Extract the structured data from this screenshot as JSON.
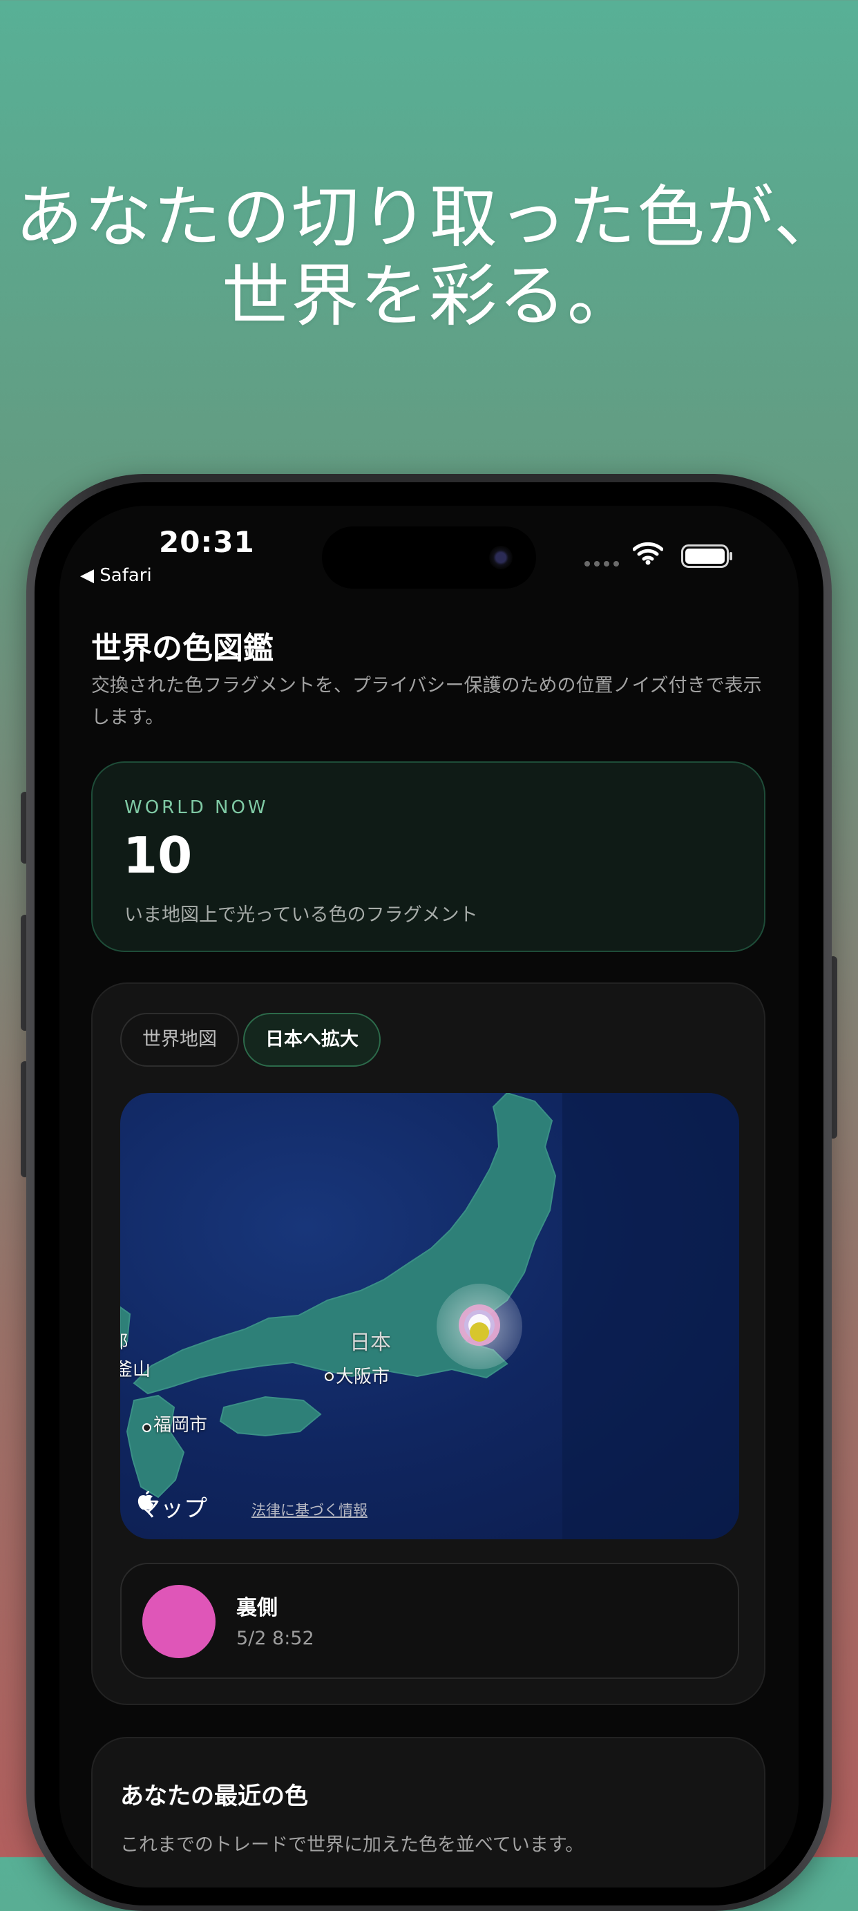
{
  "headline": {
    "line1": "あなたの切り取った色が、",
    "line2": "世界を彩る。"
  },
  "status_bar": {
    "time": "20:31",
    "back_label": "◀ Safari"
  },
  "page": {
    "title": "世界の色図鑑",
    "description": "交換された色フラグメントを、プライバシー保護のための位置ノイズ付きで表示します。"
  },
  "world_now": {
    "label": "WORLD NOW",
    "count": "10",
    "caption": "いま地図上で光っている色のフラグメント"
  },
  "map_section": {
    "tabs": [
      {
        "label": "世界地図",
        "selected": false
      },
      {
        "label": "日本へ拡大",
        "selected": true
      }
    ],
    "map": {
      "country_label": "日本",
      "cities": [
        "大阪市",
        "福岡市"
      ],
      "edge_labels": [
        "郎",
        "釜山"
      ],
      "attribution": "マップ",
      "legal_link": "法律に基づく情報"
    }
  },
  "latest_fragment": {
    "name": "裏側",
    "time": "5/2 8:52",
    "color": "#df56b8"
  },
  "recent_colors": {
    "title": "あなたの最近の色",
    "description": "これまでのトレードで世界に加えた色を並べています。"
  },
  "colors": {
    "accent_green": "#7fc9a4",
    "map_ocean": "#102660",
    "map_land": "#2e8078",
    "cluster_yellow": "#d7c62d"
  }
}
